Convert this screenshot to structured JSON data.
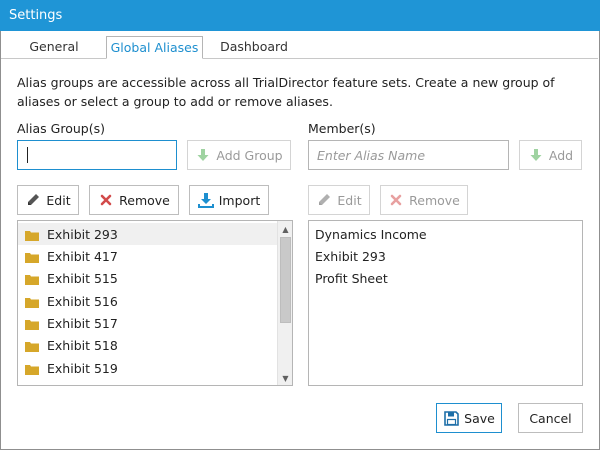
{
  "window": {
    "title": "Settings"
  },
  "tabs": [
    {
      "label": "General",
      "active": false
    },
    {
      "label": "Global Aliases",
      "active": true
    },
    {
      "label": "Dashboard",
      "active": false
    }
  ],
  "description": "Alias groups are accessible across all TrialDirector feature sets. Create a new group of aliases or select a group to add or remove aliases.",
  "alias_groups": {
    "label": "Alias Group(s)",
    "input_value": "",
    "add_group_label": "Add Group",
    "edit_label": "Edit",
    "remove_label": "Remove",
    "import_label": "Import",
    "items": [
      {
        "name": "Exhibit 293",
        "icon": "folder-icon",
        "selected": true
      },
      {
        "name": "Exhibit 417",
        "icon": "folder-icon",
        "selected": false
      },
      {
        "name": "Exhibit 515",
        "icon": "folder-icon",
        "selected": false
      },
      {
        "name": "Exhibit 516",
        "icon": "folder-icon",
        "selected": false
      },
      {
        "name": "Exhibit 517",
        "icon": "folder-icon",
        "selected": false
      },
      {
        "name": "Exhibit 518",
        "icon": "folder-icon",
        "selected": false
      },
      {
        "name": "Exhibit 519",
        "icon": "folder-icon",
        "selected": false
      }
    ]
  },
  "members": {
    "label": "Member(s)",
    "input_placeholder": "Enter Alias Name",
    "add_label": "Add",
    "edit_label": "Edit",
    "remove_label": "Remove",
    "items": [
      "Dynamics Income",
      "Exhibit 293",
      "Profit Sheet"
    ]
  },
  "footer": {
    "save_label": "Save",
    "cancel_label": "Cancel"
  },
  "colors": {
    "title_bar": "#1f95d6",
    "accent": "#1e8fcf",
    "folder": "#d6a72a",
    "green_arrow": "#7cc47f",
    "remove_x": "#d24a4a"
  }
}
